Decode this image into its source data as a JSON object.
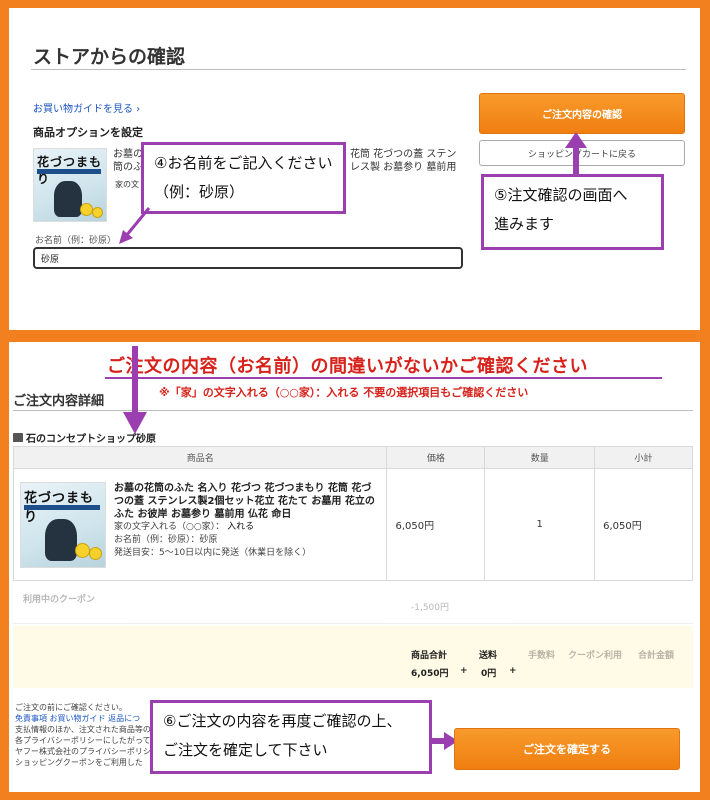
{
  "store_section": {
    "title": "ストアからの確認",
    "guide_link": "お買い物ガイドを見る ›",
    "options_heading": "商品オプションを設定",
    "product_text_left": "お墓の花筒のふた 名入り 花づつ 花づつまもり 花筒 花づつの蓋 ステンレス製2個セット",
    "product_text_right": "花筒 花づつの蓋 ステンレス製 お墓参り 墓前用 仏花…",
    "option_cut": "家の文",
    "name_label": "お名前（例：砂原）",
    "name_value": "砂原"
  },
  "thumb": {
    "title": "花づつまもり"
  },
  "buttons": {
    "confirm": "ご注文内容の確認",
    "back_to_cart": "ショッピングカートに戻る",
    "place_order": "ご注文を確定する"
  },
  "callouts": {
    "c4_line1": "④お名前をご記入ください",
    "c4_line2": "（例：砂原）",
    "c5_line1": "⑤注文確認の画面へ",
    "c5_line2": "進みます",
    "c6_line1": "⑥ご注文の内容を再度ご確認の上、",
    "c6_line2": "ご注文を確定して下さい"
  },
  "order_section": {
    "headline": "ご注文の内容（お名前）の間違いがないかご確認ください",
    "note": "※「家」の文字入れる（○○家）：入れる 不要の選択項目もご確認ください",
    "title": "ご注文内容詳細",
    "shop_name": "石のコンセプトショップ砂原",
    "columns": [
      "商品名",
      "価格",
      "数量",
      "小計"
    ],
    "item": {
      "name": "お墓の花筒のふた 名入り 花づつ 花づつまもり 花筒 花づつの蓋 ステンレス製2個セット花立 花たて お墓用 花立のふた お彼岸 お墓参り 墓前用 仏花 命日",
      "opt_family_label": "家の文字入れる（○○家）：",
      "opt_family_value": "入れる",
      "opt_name": "お名前（例：砂原）：砂原",
      "opt_ship": "発送目安：5〜10日以内に発送（休業日を除く）",
      "price": "6,050円",
      "qty": "1",
      "subtotal": "6,050円"
    },
    "coupon_label": "利用中のクーポン",
    "coupon_value": "-1,500円",
    "summary": {
      "goods_label": "商品合計",
      "goods_value": "6,050円",
      "shipping_label": "送料",
      "shipping_value": "0円",
      "fee_label": "手数料",
      "coupon_use_label": "クーポン利用",
      "total_label": "合計金額",
      "plus": "+"
    },
    "fine_print": {
      "l1": "ご注文の前にご確認ください。",
      "l2_link1": "免責事項",
      "l2_link2": "お買い物ガイド",
      "l2_rest": "返品につ",
      "l3": "支払情報のほか、注文された商品等の",
      "l4": "各プライバシーポリシーにしたがって",
      "l5": "ヤフー株式会社のプライバシーポリシ",
      "l6": "ショッピングクーポンをご利用した"
    }
  },
  "colors": {
    "background": "#f3801f",
    "accent_orange": "#f07f10",
    "callout_border": "#9b3fb0",
    "headline_red": "#d6221b"
  }
}
